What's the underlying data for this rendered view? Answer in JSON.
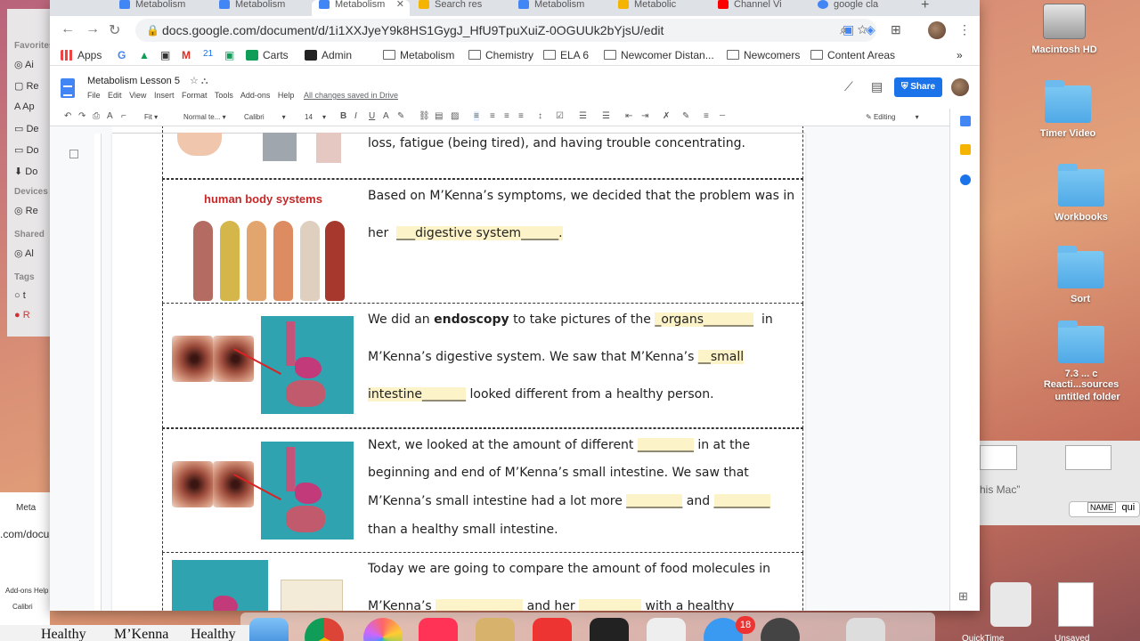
{
  "browser": {
    "tabs": [
      {
        "label": "Metabolism",
        "color": "#4285f4"
      },
      {
        "label": "Metabolism",
        "color": "#4285f4"
      },
      {
        "label": "Metabolism",
        "color": "#4285f4"
      },
      {
        "label": "Search res",
        "color": "#f4b400"
      },
      {
        "label": "Metabolism",
        "color": "#4285f4"
      },
      {
        "label": "Metabolic",
        "color": "#f4b400"
      },
      {
        "label": "Channel Vi",
        "color": "#ff0000"
      },
      {
        "label": "google cla",
        "color": "#4285f4"
      }
    ],
    "url": "docs.google.com/document/d/1i1XXJyeY9k8HS1GygJ_HfU9TpuXuiZ-0OGUUk2bYjsU/edit",
    "bookmarks": [
      "Apps",
      "Carts",
      "Admin",
      "Metabolism",
      "Chemistry",
      "ELA 6",
      "Newcomer Distan...",
      "Newcomers",
      "Content Areas"
    ]
  },
  "docs": {
    "title": "Metabolism Lesson 5",
    "menus": [
      "File",
      "Edit",
      "View",
      "Insert",
      "Format",
      "Tools",
      "Add-ons",
      "Help"
    ],
    "saved_status": "All changes saved in Drive",
    "share_label": "Share",
    "toolbar": {
      "zoom": "Fit",
      "style": "Normal te...",
      "font": "Calibri",
      "size": "14",
      "mode": "Editing"
    }
  },
  "rows": {
    "r0": {
      "l1": "loss, fatigue (being tired), and having trouble concentrating."
    },
    "r1": {
      "caption": "human body systems",
      "l1": "Based on M’Kenna’s symptoms, we decided that the problem was in",
      "l2a": "her",
      "l2b": "___digestive system______."
    },
    "r2": {
      "l1a": "We did an",
      "l1b": "endoscopy",
      "l1c": "to take pictures of the",
      "l1d": "_organs________",
      "l1e": "in",
      "l2a": "M’Kenna’s digestive system.  We saw that M’Kenna’s",
      "l2b": "__small",
      "l3a": "intestine_______",
      "l3b": "looked different from a healthy person."
    },
    "r3": {
      "l1a": "Next, we looked at the amount of different",
      "l1b": "_________",
      "l1c": "in at the",
      "l2": "beginning and end of M’Kenna’s small intestine. We saw that",
      "l3a": "M’Kenna’s small intestine had a lot more",
      "l3b": "_________",
      "l3c": "and",
      "l3d": "_________",
      "l4": "than a healthy small intestine."
    },
    "r4": {
      "l1": "Today we are going to compare the amount of food molecules in",
      "l2a": "M’Kenna’s",
      "l2b": "______________",
      "l2c": "and her",
      "l2d": "__________",
      "l2e": "with a healthy"
    }
  },
  "desktop": {
    "icons": [
      "Macintosh HD",
      "Timer Video",
      "Workbooks",
      "Sort",
      "7.3 ... c Reacti...sources",
      "untitled folder"
    ],
    "finder_sections": [
      "Favorites",
      "Devices",
      "Shared",
      "Tags"
    ],
    "finder_search": "NAME",
    "finder_search_value": "qui",
    "finder_path": "his Mac”",
    "dock_badge": "18",
    "bottom_texts": [
      "Healthy",
      "M’Kenna",
      "Healthy"
    ],
    "bottom_right": [
      "QuickTime",
      "Unsaved"
    ]
  }
}
